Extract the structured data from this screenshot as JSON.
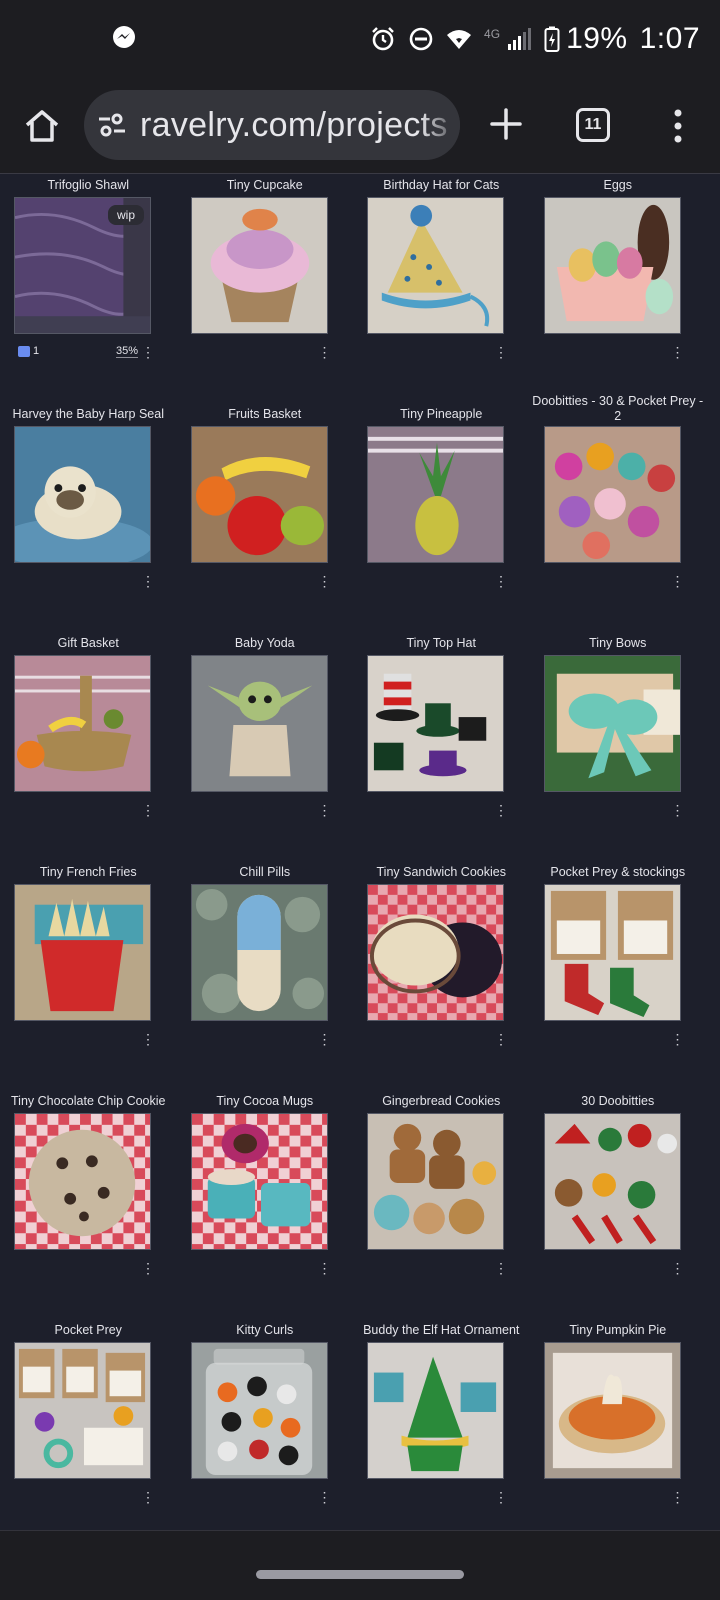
{
  "status_bar": {
    "messenger_icon": "messenger-icon",
    "alarm_icon": "alarm-icon",
    "dnd_icon": "do-not-disturb-icon",
    "wifi_icon": "wifi-icon",
    "network_label": "4G",
    "signal_icon": "signal-icon",
    "battery_icon": "battery-charging-icon",
    "battery_text": "19%",
    "time": "1:07"
  },
  "browser": {
    "url": "ravelry.com/projects",
    "tab_count": "11",
    "home_icon": "home-icon",
    "site_settings_icon": "tune-icon",
    "new_tab_icon": "plus-icon",
    "menu_icon": "more-vert-icon"
  },
  "projects": [
    {
      "title": "Trifoglio Shawl",
      "badge": "wip",
      "comments": "1",
      "progress": "35%"
    },
    {
      "title": "Tiny Cupcake"
    },
    {
      "title": "Birthday Hat for Cats"
    },
    {
      "title": "Eggs"
    },
    {
      "title": "Harvey the Baby Harp Seal"
    },
    {
      "title": "Fruits Basket"
    },
    {
      "title": "Tiny Pineapple"
    },
    {
      "title": "Doobitties - 30 & Pocket Prey - 2"
    },
    {
      "title": "Gift Basket"
    },
    {
      "title": "Baby Yoda"
    },
    {
      "title": "Tiny Top Hat"
    },
    {
      "title": "Tiny Bows"
    },
    {
      "title": "Tiny French Fries"
    },
    {
      "title": "Chill Pills"
    },
    {
      "title": "Tiny Sandwich Cookies"
    },
    {
      "title": "Pocket Prey & stockings"
    },
    {
      "title": "Tiny Chocolate Chip Cookie"
    },
    {
      "title": "Tiny Cocoa Mugs"
    },
    {
      "title": "Gingerbread Cookies"
    },
    {
      "title": "30 Doobitties"
    },
    {
      "title": "Pocket Prey"
    },
    {
      "title": "Kitty Curls"
    },
    {
      "title": "Buddy the Elf Hat Ornament"
    },
    {
      "title": "Tiny Pumpkin Pie"
    }
  ],
  "more_glyph": "⋮",
  "colors": {
    "page_bg": "#1d1f2b",
    "chrome_bg": "#1d1d21",
    "url_bg": "#34353b",
    "accent_comment": "#6a8cf0"
  }
}
